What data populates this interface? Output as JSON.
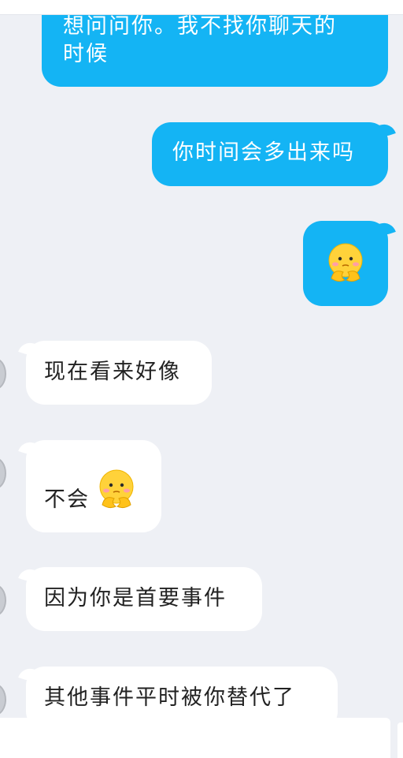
{
  "colors": {
    "outgoing_bubble": "#14b4f4",
    "incoming_bubble": "#ffffff",
    "background": "#eef0f5"
  },
  "messages": [
    {
      "direction": "outgoing",
      "lines": [
        "想问问你。我不找你聊天的",
        "时候"
      ]
    },
    {
      "direction": "outgoing",
      "text": "你时间会多出来吗"
    },
    {
      "direction": "outgoing",
      "sticker": "thinking-face-emoji"
    },
    {
      "direction": "incoming",
      "text": "现在看来好像"
    },
    {
      "direction": "incoming",
      "text": "不会",
      "sticker": "thinking-face-emoji"
    },
    {
      "direction": "incoming",
      "text": "因为你是首要事件"
    },
    {
      "direction": "incoming",
      "text": "其他事件平时被你替代了"
    }
  ]
}
